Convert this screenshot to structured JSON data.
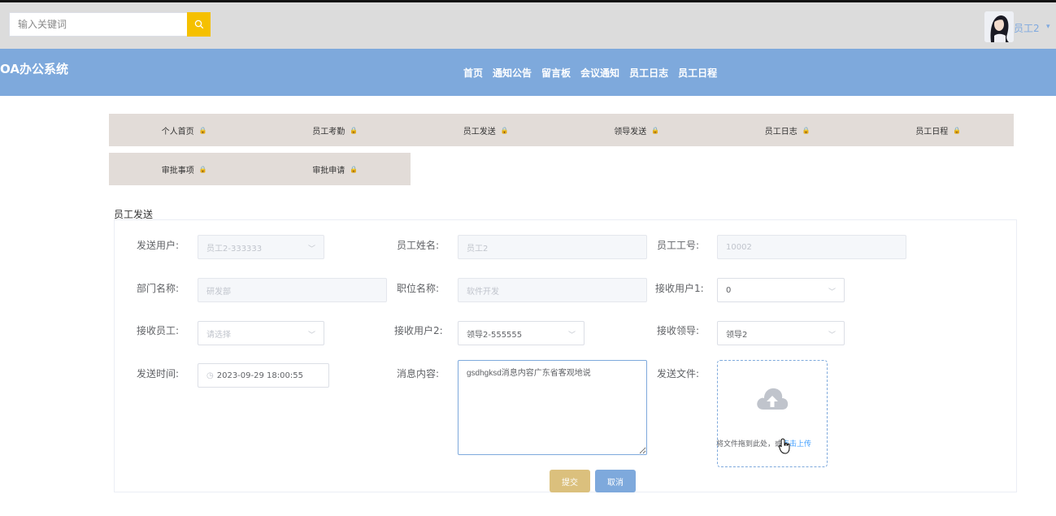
{
  "header": {
    "search_placeholder": "输入关键词",
    "user_name": "员工2",
    "accent_color": "#7ea9dc",
    "search_button_color": "#f5c000"
  },
  "nav": {
    "brand": "OA办公系统",
    "items": [
      "首页",
      "通知公告",
      "留言板",
      "会议通知",
      "员工日志",
      "员工日程"
    ]
  },
  "tabs": {
    "row1": [
      "个人首页",
      "员工考勤",
      "员工发送",
      "领导发送",
      "员工日志",
      "员工日程"
    ],
    "row2": [
      "审批事项",
      "审批申请"
    ],
    "lock_icon": "🔒"
  },
  "form": {
    "title": "员工发送",
    "labels": {
      "send_user": "发送用户:",
      "emp_name": "员工姓名:",
      "emp_no": "员工工号:",
      "dept": "部门名称:",
      "position": "职位名称:",
      "recv_user1": "接收用户1:",
      "recv_emp": "接收员工:",
      "recv_user2": "接收用户2:",
      "recv_leader": "接收领导:",
      "send_time": "发送时间:",
      "message": "消息内容:",
      "send_file": "发送文件:"
    },
    "values": {
      "send_user": "员工2-333333",
      "emp_name": "员工2",
      "emp_no": "10002",
      "dept": "研发部",
      "position": "软件开发",
      "recv_user1": "0",
      "recv_emp_placeholder": "请选择",
      "recv_user2": "领导2-555555",
      "recv_leader": "领导2",
      "send_time": "2023-09-29 18:00:55",
      "message": "gsdhgksd消息内容广东省客观地说"
    },
    "upload": {
      "text": "将文件拖到此处，或",
      "link": "点击上传"
    },
    "buttons": {
      "submit": "提交",
      "cancel": "取消"
    }
  }
}
